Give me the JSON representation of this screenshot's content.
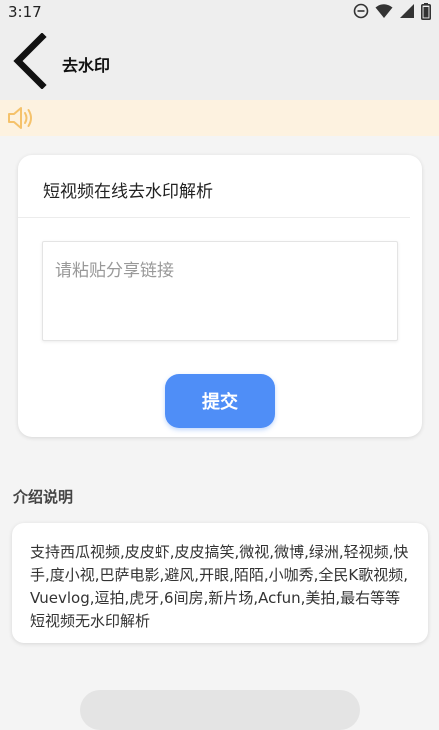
{
  "status_bar": {
    "time": "3:17",
    "icons": [
      "do-not-disturb-icon",
      "wifi-icon",
      "signal-icon",
      "battery-icon"
    ]
  },
  "app_bar": {
    "back_icon": "chevron-left-icon",
    "title": "去水印"
  },
  "notice": {
    "icon": "speaker-icon",
    "accent_color": "#f5c26b",
    "background": "#fdf2e0"
  },
  "parse_card": {
    "title": "短视频在线去水印解析",
    "link_input": {
      "value": "",
      "placeholder": "请粘贴分享链接"
    },
    "submit_label": "提交",
    "submit_color": "#4f8ef7"
  },
  "intro": {
    "heading": "介绍说明",
    "text": "支持西瓜视频,皮皮虾,皮皮搞笑,微视,微博,绿洲,轻视频,快手,度小视,巴萨电影,避风,开眼,陌陌,小咖秀,全民K歌视频,Vuevlog,逗拍,虎牙,6间房,新片场,Acfun,美拍,最右等等短视频无水印解析"
  }
}
